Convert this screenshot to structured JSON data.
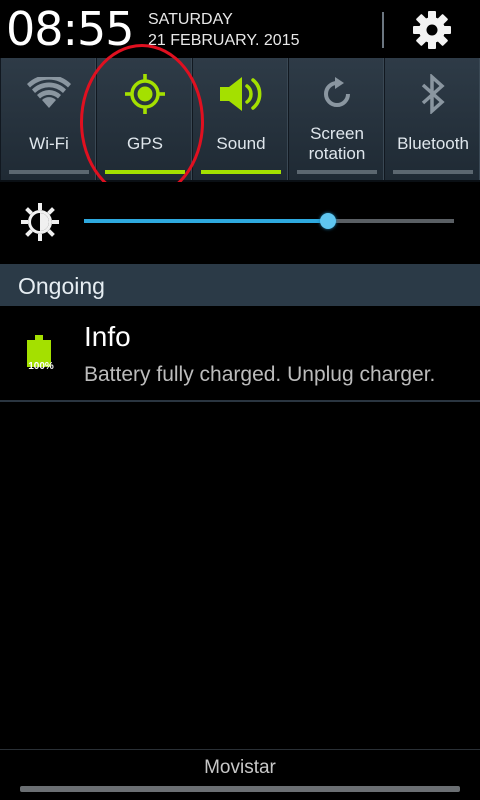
{
  "status": {
    "time": "08:55",
    "day": "SATURDAY",
    "date": "21 FEBRUARY. 2015",
    "settings_icon": "gear-icon"
  },
  "quick_settings": [
    {
      "label": "Wi-Fi",
      "icon": "wifi-icon",
      "active": false
    },
    {
      "label": "GPS",
      "icon": "gps-icon",
      "active": true
    },
    {
      "label": "Sound",
      "icon": "sound-icon",
      "active": true
    },
    {
      "label": "Screen rotation",
      "icon": "rotation-icon",
      "active": false
    },
    {
      "label": "Bluetooth",
      "icon": "bluetooth-icon",
      "active": false
    }
  ],
  "brightness": {
    "icon": "brightness-auto-icon",
    "level": 0.66
  },
  "ongoing": {
    "section_label": "Ongoing",
    "notifications": [
      {
        "icon": "battery-icon",
        "battery_level": "100%",
        "title": "Info",
        "text": "Battery fully charged. Unplug charger."
      }
    ]
  },
  "footer": {
    "carrier": "Movistar"
  },
  "colors": {
    "accent_green": "#a4e000",
    "slider_blue": "#2ea9df",
    "annotation_red": "#e01020",
    "toggle_bg": "#1e2c38"
  }
}
